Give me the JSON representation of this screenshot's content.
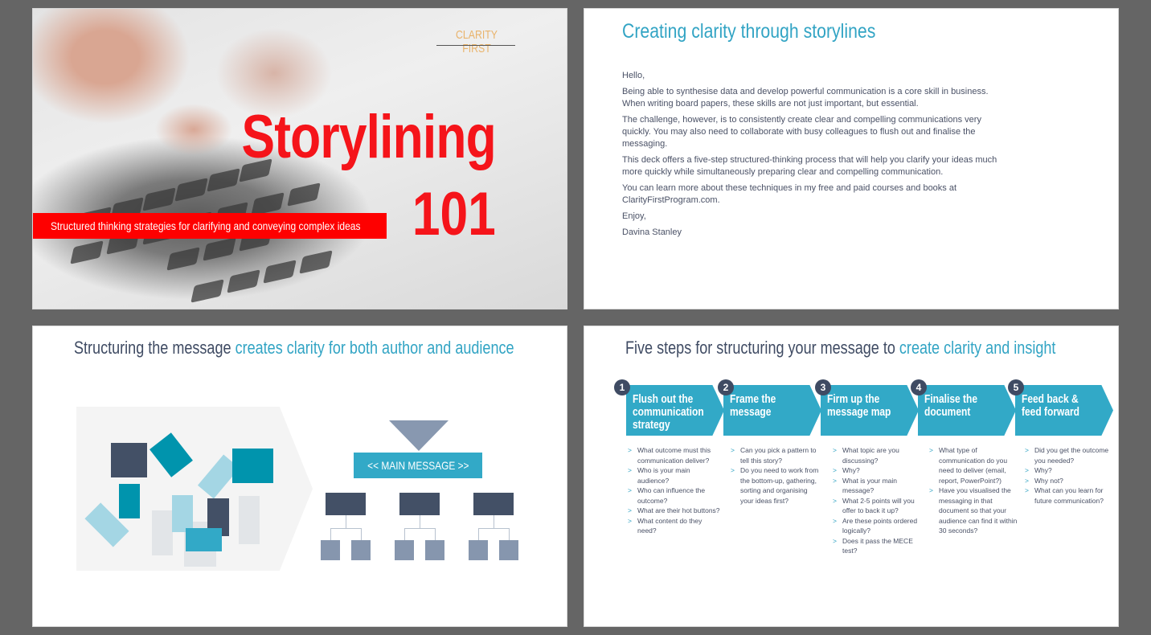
{
  "slides": {
    "title_slide": {
      "brand": "CLARITY FIRST",
      "title": "Storylining",
      "number": "101",
      "subtitle": "Structured thinking strategies for clarifying and conveying complex ideas"
    },
    "intro_slide": {
      "title": "Creating clarity through storylines",
      "paragraphs": [
        "Hello,",
        "Being able to synthesise data and develop powerful communication is a core skill in business. When writing board papers, these skills are not just important, but essential.",
        "The challenge, however, is to consistently create clear and compelling communications very quickly. You may also need to collaborate with busy colleagues to flush out and finalise the messaging.",
        "This deck offers a five-step structured-thinking process that will help you clarify your ideas much more quickly while simultaneously preparing clear and compelling communication.",
        "You can learn more about these techniques in my free and paid courses and books at ClarityFirstProgram.com.",
        "Enjoy,",
        "Davina Stanley"
      ]
    },
    "structure_slide": {
      "title_dark": "Structuring the message",
      "title_accent": "creates clarity for both author and audience",
      "main_message": "<< MAIN MESSAGE >>"
    },
    "steps_slide": {
      "title_dark": "Five steps for structuring your message to",
      "title_accent": "create clarity and insight",
      "steps": [
        {
          "number": "1",
          "label": "Flush out the communication strategy",
          "questions": [
            "What outcome must this communication deliver?",
            "Who is your main audience?",
            "Who can influence the outcome?",
            "What are their hot buttons?",
            "What content do they need?"
          ]
        },
        {
          "number": "2",
          "label": "Frame the message",
          "questions": [
            "Can you pick a pattern to tell this story?",
            "Do you need to work from the bottom-up, gathering, sorting and organising your ideas first?"
          ]
        },
        {
          "number": "3",
          "label": "Firm up the message map",
          "questions": [
            "What topic are you discussing?",
            "Why?",
            "What is your main message?",
            "What 2-5 points will you offer to back it up?",
            "Are these points ordered logically?",
            "Does it pass the MECE test?"
          ]
        },
        {
          "number": "4",
          "label": "Finalise the document",
          "questions": [
            "What type of communication do you need to deliver (email, report, PowerPoint?)",
            "Have you visualised the messaging in that document so that your audience can find it within 30 seconds?"
          ]
        },
        {
          "number": "5",
          "label": "Feed back & feed forward",
          "questions": [
            "Did you get the outcome you needed?",
            "Why?",
            "Why not?",
            "What can you learn for future communication?"
          ]
        }
      ]
    }
  },
  "colors": {
    "accent_teal": "#32a4c4",
    "dark_navy": "#3f4b63",
    "title_red": "#f5141a",
    "brand_gold": "#e9b36b"
  }
}
